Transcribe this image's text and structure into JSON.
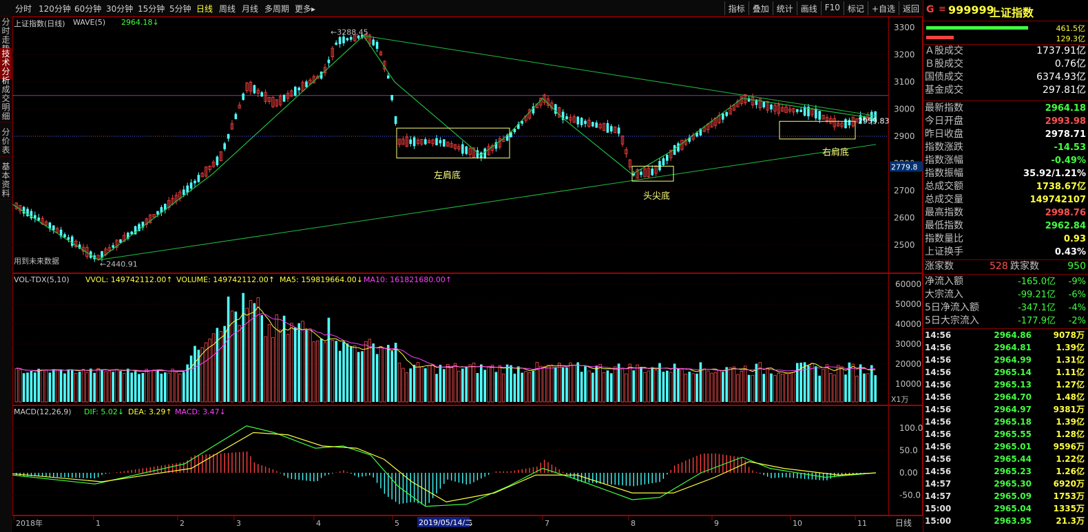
{
  "toolbar": {
    "periods": [
      "分时",
      "120分钟",
      "60分钟",
      "30分钟",
      "15分钟",
      "5分钟",
      "日线",
      "周线",
      "月线",
      "多周期",
      "更多▸"
    ],
    "active_period": "日线",
    "right_tools": [
      "指标",
      "叠加",
      "统计",
      "画线",
      "F10",
      "标记",
      "+自选",
      "返回"
    ]
  },
  "left_tabs": [
    "分时走势",
    "技术分析",
    "成交明细",
    "分价表",
    "基本资料"
  ],
  "main_chart": {
    "title": "上证指数(日线)",
    "indicator": "WAVE(5)",
    "indicator_value": "2964.18↓",
    "y_ticks": [
      "3300",
      "3200",
      "3100",
      "3000",
      "2900",
      "2800",
      "2700",
      "2600",
      "2500"
    ],
    "current_price_label": "2779.8",
    "last_price_tag": "2959.83",
    "high_label": "3288.45",
    "low_label": "2440.91",
    "note": "用到未来数据",
    "annotations": [
      "左肩底",
      "头尖底",
      "右肩底"
    ]
  },
  "volume_panel": {
    "title": "VOL-TDX(5,10)",
    "vvol": "VVOL: 149742112.00↑",
    "volume": "VOLUME: 149742112.00↑",
    "ma5": "MA5: 159819664.00↓",
    "ma10": "MA10: 161821680.00↑",
    "y_ticks": [
      "60000",
      "50000",
      "40000",
      "30000",
      "20000",
      "10000"
    ],
    "unit": "X1万"
  },
  "macd_panel": {
    "title": "MACD(12,26,9)",
    "dif": "DIF: 5.02↓",
    "dea": "DEA: 3.29↑",
    "macd": "MACD: 3.47↓",
    "y_ticks": [
      "100.0",
      "50.0",
      "0.00",
      "-50.0"
    ]
  },
  "x_axis": {
    "labels": [
      "2018年",
      "1",
      "2",
      "3",
      "4",
      "5",
      "6",
      "7",
      "8",
      "9",
      "10",
      "11"
    ],
    "cursor_date": "2019/05/14/二",
    "period_label": "日线"
  },
  "right_panel": {
    "code": "999999",
    "name": "上证指数",
    "vol_bar_top": "461.5亿",
    "vol_bar_bottom": "129.3亿",
    "stats": [
      {
        "label": "Ａ股成交",
        "value": "1737.91亿",
        "cls": "wh"
      },
      {
        "label": "Ｂ股成交",
        "value": "0.76亿",
        "cls": "wh"
      },
      {
        "label": "国债成交",
        "value": "6374.93亿",
        "cls": "wh"
      },
      {
        "label": "基金成交",
        "value": "297.81亿",
        "cls": "wh"
      }
    ],
    "quote": [
      {
        "label": "最新指数",
        "value": "2964.18",
        "cls": "dn"
      },
      {
        "label": "今日开盘",
        "value": "2993.98",
        "cls": "up"
      },
      {
        "label": "昨日收盘",
        "value": "2978.71",
        "cls": "wh"
      },
      {
        "label": "指数涨跌",
        "value": "-14.53",
        "cls": "dn"
      },
      {
        "label": "指数涨幅",
        "value": "-0.49%",
        "cls": "dn"
      },
      {
        "label": "指数振幅",
        "value": "35.92/1.21%",
        "cls": "wh"
      },
      {
        "label": "总成交额",
        "value": "1738.67亿",
        "cls": "yl"
      },
      {
        "label": "总成交量",
        "value": "149742107",
        "cls": "yl"
      },
      {
        "label": "最高指数",
        "value": "2998.76",
        "cls": "up"
      },
      {
        "label": "最低指数",
        "value": "2962.84",
        "cls": "dn"
      },
      {
        "label": "指数量比",
        "value": "0.93",
        "cls": "yl"
      },
      {
        "label": "上证换手",
        "value": "0.43%",
        "cls": "wh"
      }
    ],
    "breadth": {
      "up_label": "涨家数",
      "up_value": "528",
      "down_label": "跌家数",
      "down_value": "950"
    },
    "flows": [
      {
        "label": "净流入额",
        "value": "-165.0亿",
        "pct": "-9%"
      },
      {
        "label": "大宗流入",
        "value": "-99.21亿",
        "pct": "-6%"
      },
      {
        "label": "5日净流入额",
        "value": "-347.1亿",
        "pct": "-4%"
      },
      {
        "label": "5日大宗流入",
        "value": "-177.9亿",
        "pct": "-2%"
      }
    ],
    "ticks": [
      {
        "t": "14:56",
        "p": "2964.86",
        "v": "9078万"
      },
      {
        "t": "14:56",
        "p": "2964.81",
        "v": "1.39亿"
      },
      {
        "t": "14:56",
        "p": "2964.99",
        "v": "1.31亿"
      },
      {
        "t": "14:56",
        "p": "2965.14",
        "v": "1.11亿"
      },
      {
        "t": "14:56",
        "p": "2965.13",
        "v": "1.27亿"
      },
      {
        "t": "14:56",
        "p": "2964.70",
        "v": "1.48亿"
      },
      {
        "t": "14:56",
        "p": "2964.97",
        "v": "9381万"
      },
      {
        "t": "14:56",
        "p": "2965.18",
        "v": "1.39亿"
      },
      {
        "t": "14:56",
        "p": "2965.55",
        "v": "1.28亿"
      },
      {
        "t": "14:56",
        "p": "2965.01",
        "v": "9596万"
      },
      {
        "t": "14:56",
        "p": "2965.44",
        "v": "1.22亿"
      },
      {
        "t": "14:56",
        "p": "2965.23",
        "v": "1.26亿"
      },
      {
        "t": "14:57",
        "p": "2965.30",
        "v": "6920万"
      },
      {
        "t": "14:57",
        "p": "2965.09",
        "v": "1753万"
      },
      {
        "t": "15:00",
        "p": "2965.04",
        "v": "1335万"
      },
      {
        "t": "15:00",
        "p": "2963.95",
        "v": "21.3万"
      }
    ]
  }
}
